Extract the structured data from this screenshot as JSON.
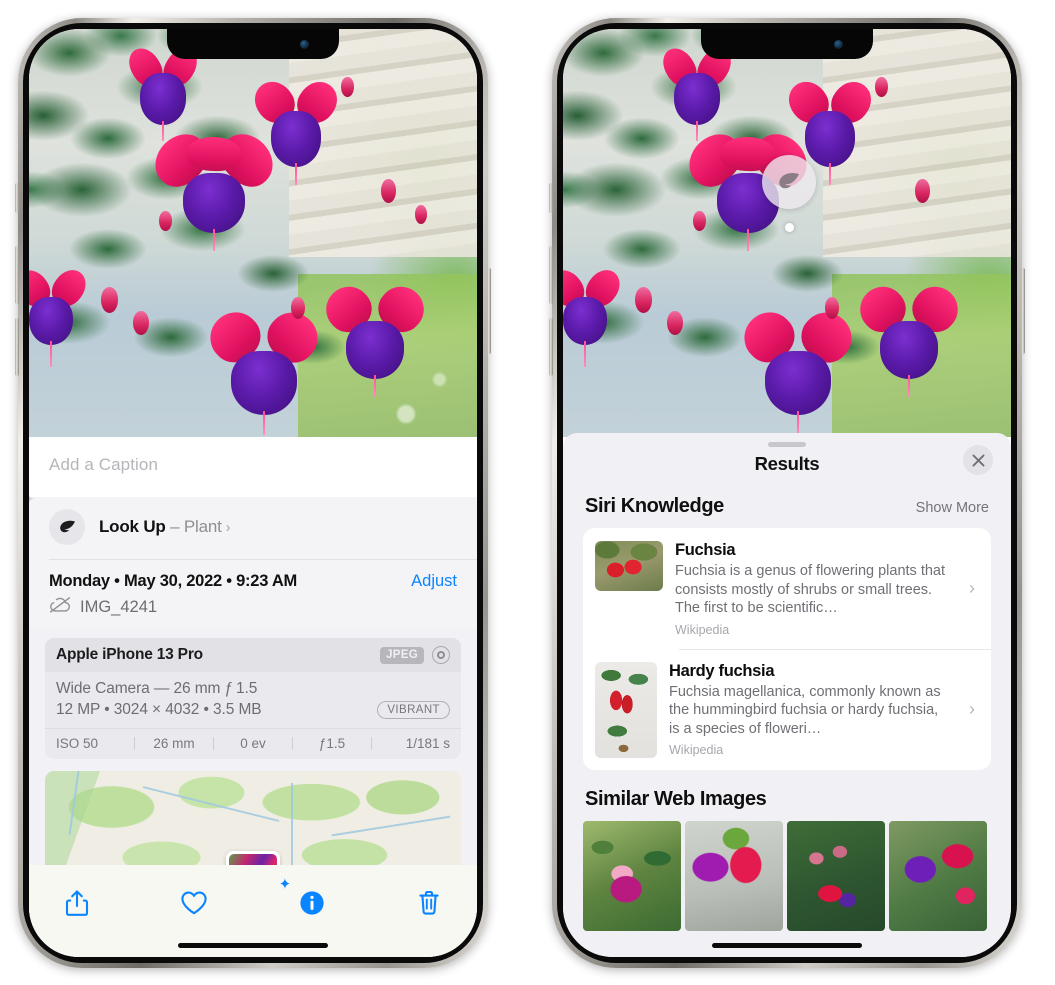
{
  "left_phone": {
    "caption_placeholder": "Add a Caption",
    "lookup": {
      "label": "Look Up",
      "dash": " – ",
      "subject": "Plant",
      "chevron": "›",
      "icon": "leaf-icon"
    },
    "meta": {
      "date": "Monday • May 30, 2022 • 9:23 AM",
      "adjust_label": "Adjust",
      "filename": "IMG_4241",
      "cloud_icon": "icloud-slash-icon"
    },
    "camera_card": {
      "model": "Apple iPhone 13 Pro",
      "format_badge": "JPEG",
      "hdr_icon": "hdr-ring-icon",
      "lens_line": "Wide Camera — 26 mm ƒ 1.5",
      "size_line": "12 MP • 3024 × 4032 • 3.5 MB",
      "style_badge": "VIBRANT",
      "exif": [
        "ISO 50",
        "26 mm",
        "0 ev",
        "ƒ1.5",
        "1/181 s"
      ]
    },
    "toolbar": [
      {
        "name": "share-button",
        "icon": "share-icon"
      },
      {
        "name": "favorite-button",
        "icon": "heart-icon"
      },
      {
        "name": "info-button",
        "icon": "info-sparkle-icon"
      },
      {
        "name": "delete-button",
        "icon": "trash-icon"
      }
    ]
  },
  "right_phone": {
    "visual_lookup_badge": {
      "icon": "leaf-icon"
    },
    "sheet": {
      "title": "Results",
      "close_icon": "close-icon",
      "section": {
        "title": "Siri Knowledge",
        "show_more": "Show More"
      },
      "knowledge_cards": [
        {
          "title": "Fuchsia",
          "description": "Fuchsia is a genus of flowering plants that consists mostly of shrubs or small trees. The first to be scientific…",
          "source": "Wikipedia",
          "chevron": "›"
        },
        {
          "title": "Hardy fuchsia",
          "description": "Fuchsia magellanica, commonly known as the hummingbird fuchsia or hardy fuchsia, is a species of floweri…",
          "source": "Wikipedia",
          "chevron": "›"
        }
      ],
      "similar_images": {
        "title": "Similar Web Images",
        "count": 4
      }
    }
  },
  "colors": {
    "accent_blue": "#0a84ff",
    "sheet_bg": "#f1f1f5",
    "card_bg": "#ffffff",
    "secondary_text": "#6f6f75"
  }
}
